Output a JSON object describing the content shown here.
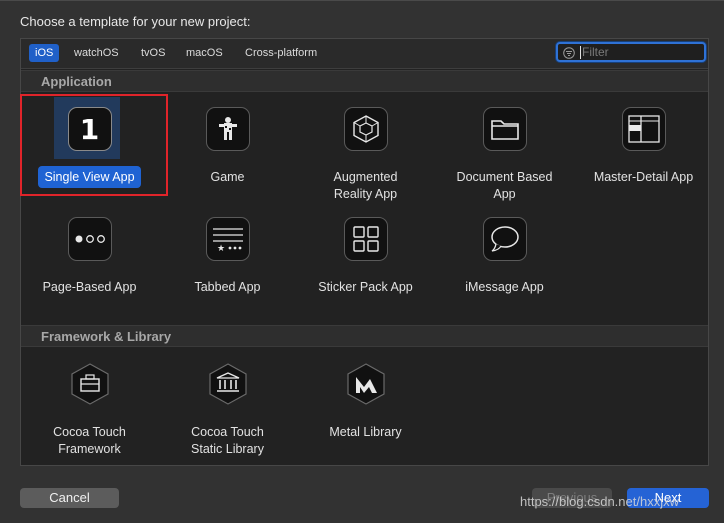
{
  "dialog": {
    "title": "Choose a template for your new project:"
  },
  "platforms": [
    "iOS",
    "watchOS",
    "tvOS",
    "macOS",
    "Cross-platform"
  ],
  "filter": {
    "placeholder": "Filter",
    "value": ""
  },
  "sections": {
    "application": "Application",
    "framework": "Framework & Library"
  },
  "application_templates": [
    {
      "label": "Single View App",
      "icon": "single-view-icon"
    },
    {
      "label": "Game",
      "icon": "game-icon"
    },
    {
      "label": "Augmented\nReality App",
      "icon": "ar-cube-icon"
    },
    {
      "label": "Document Based\nApp",
      "icon": "folder-icon"
    },
    {
      "label": "Master-Detail App",
      "icon": "master-detail-icon"
    },
    {
      "label": "Page-Based App",
      "icon": "page-dots-icon"
    },
    {
      "label": "Tabbed App",
      "icon": "tabbed-icon"
    },
    {
      "label": "Sticker Pack App",
      "icon": "sticker-grid-icon"
    },
    {
      "label": "iMessage App",
      "icon": "message-bubble-icon"
    }
  ],
  "framework_templates": [
    {
      "label": "Cocoa Touch\nFramework",
      "icon": "toolbox-icon"
    },
    {
      "label": "Cocoa Touch\nStatic Library",
      "icon": "library-icon"
    },
    {
      "label": "Metal Library",
      "icon": "metal-icon"
    }
  ],
  "single_view_digit": "1",
  "buttons": {
    "cancel": "Cancel",
    "previous": "Previous",
    "next": "Next"
  },
  "watermark": "https://blog.csdn.net/hxxjxw",
  "colors": {
    "accent": "#2563d5",
    "selection_box": "#e0242a"
  }
}
